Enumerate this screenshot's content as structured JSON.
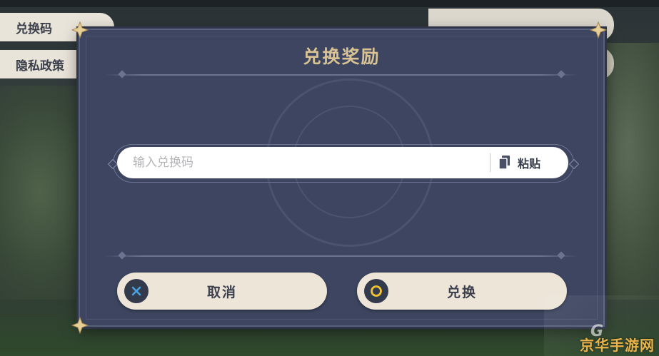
{
  "side_menu": {
    "items": [
      {
        "label": "兑换码"
      },
      {
        "label": "隐私政策"
      }
    ]
  },
  "dialog": {
    "title": "兑换奖励",
    "input": {
      "placeholder": "输入兑换码",
      "value": ""
    },
    "paste_label": "粘贴",
    "cancel_label": "取消",
    "confirm_label": "兑换"
  },
  "watermark": {
    "text": "京华手游网"
  },
  "colors": {
    "dialog_bg": "#3d4560",
    "title_gold": "#d9c393",
    "button_bg": "#ece5d8",
    "cancel_icon_blue": "#4aa3e0",
    "confirm_icon_gold": "#f0c330"
  },
  "icons": {
    "paste": "clipboard-icon",
    "cancel": "x-icon",
    "confirm": "circle-icon"
  }
}
